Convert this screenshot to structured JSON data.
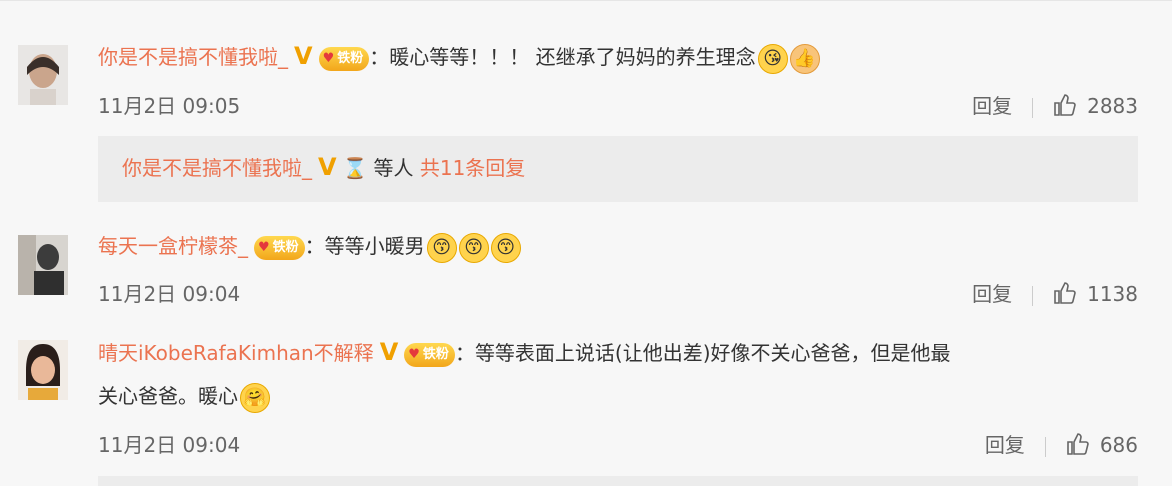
{
  "comments": [
    {
      "username": "你是不是搞不懂我啦_",
      "verified": "V",
      "fan_badge": "铁粉",
      "colon": "：",
      "text": "暖心等等！！！ 还继承了妈妈的养生理念",
      "emojis": [
        "😘",
        "👍"
      ],
      "time": "11月2日 09:05",
      "reply_label": "回复",
      "likes": "2883",
      "reply_preview": {
        "username": "你是不是搞不懂我啦_",
        "verified": "V",
        "text": "等人",
        "count_text": "共11条回复"
      }
    },
    {
      "username": "每天一盒柠檬茶_",
      "fan_badge": "铁粉",
      "colon": "：",
      "text": "等等小暖男",
      "emojis": [
        "😙",
        "😙",
        "😙"
      ],
      "time": "11月2日 09:04",
      "reply_label": "回复",
      "likes": "1138"
    },
    {
      "username": "晴天iKobeRafaKimhan不解释",
      "verified": "V",
      "fan_badge": "铁粉",
      "colon": "：",
      "text_line1": "等等表面上说话(让他出差)好像不关心爸爸，但是他最",
      "text_line2": "关心爸爸。暖心",
      "emojis": [
        "🤗"
      ],
      "time": "11月2日 09:04",
      "reply_label": "回复",
      "likes": "686"
    }
  ],
  "icons": {
    "like": "thumb-up-icon",
    "verified": "verified-v-icon",
    "fan": "fan-badge-icon"
  },
  "colors": {
    "username": "#eb7350",
    "verified": "#f0a000",
    "badge": "#f2a61b"
  }
}
